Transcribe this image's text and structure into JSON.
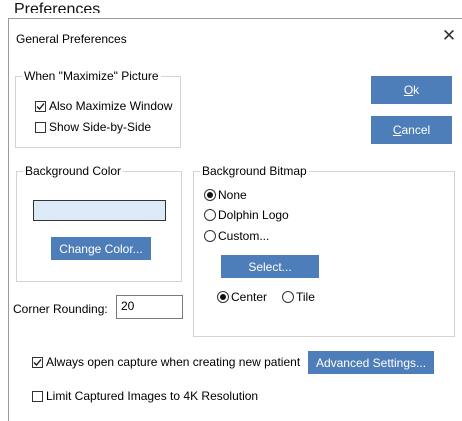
{
  "page": {
    "heading": "Preferences"
  },
  "dialog": {
    "title": "General Preferences",
    "close_glyph": "✕"
  },
  "maximize_group": {
    "legend": "When \"Maximize\" Picture",
    "also_maximize": {
      "label": "Also Maximize Window",
      "checked": true
    },
    "side_by_side": {
      "label": "Show Side-by-Side",
      "checked": false
    }
  },
  "buttons": {
    "ok": {
      "label": "Ok",
      "mnemonic": "O",
      "rest": "k"
    },
    "cancel": {
      "label": "Cancel",
      "mnemonic": "C",
      "rest": "ancel"
    },
    "change_color": "Change Color...",
    "select": "Select...",
    "advanced": "Advanced Settings..."
  },
  "bg_color_group": {
    "legend": "Background Color",
    "swatch_color": "#dce9f7"
  },
  "bg_bitmap_group": {
    "legend": "Background Bitmap",
    "options": [
      "None",
      "Dolphin Logo",
      "Custom..."
    ],
    "selected": "None",
    "placement_options": [
      "Center",
      "Tile"
    ],
    "placement_selected": "Center"
  },
  "corner_rounding": {
    "label": "Corner Rounding:",
    "value": "20"
  },
  "options": {
    "always_open_capture": {
      "label": "Always open capture when creating new patient",
      "checked": true
    },
    "limit_4k": {
      "label": "Limit Captured Images to 4K Resolution",
      "checked": false
    }
  },
  "colors": {
    "accent_button": "#4e7eba"
  },
  "icons": {
    "close": "close-icon",
    "check": "check-icon"
  }
}
